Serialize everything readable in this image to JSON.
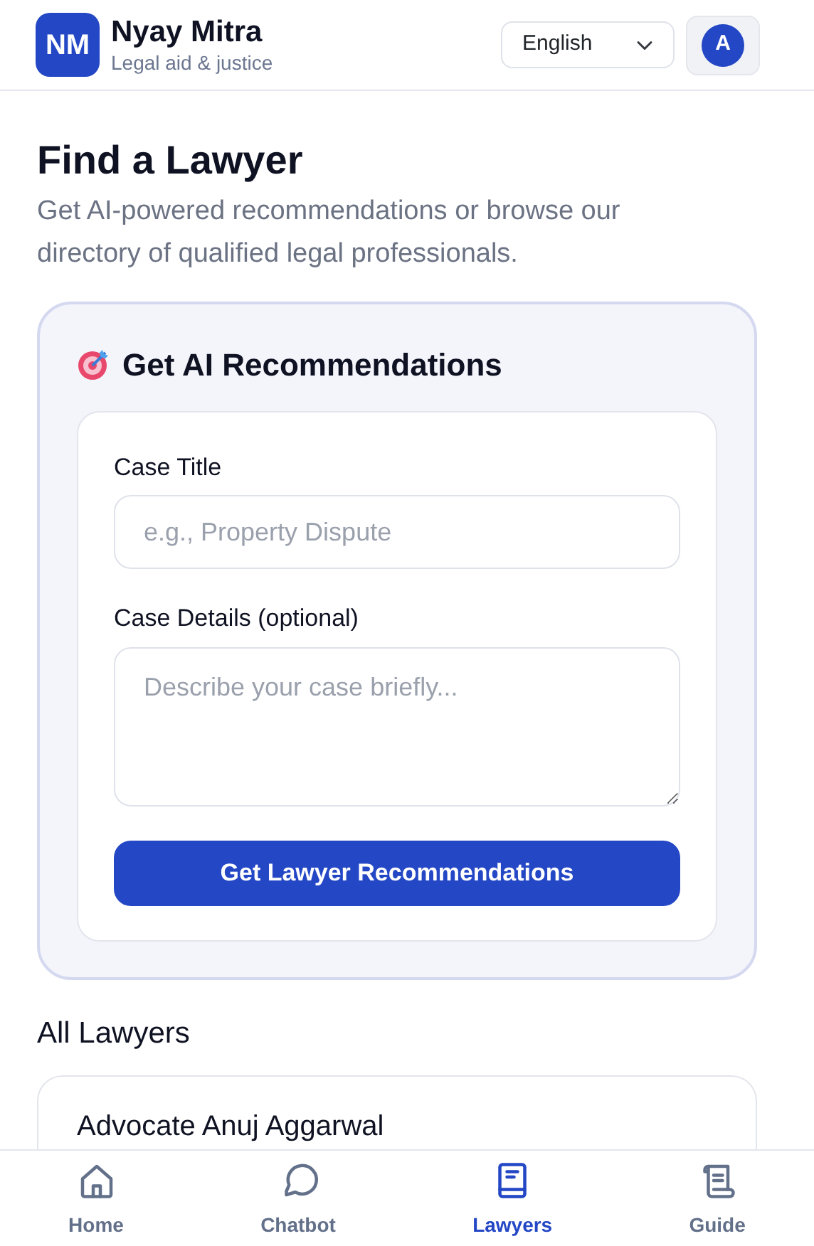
{
  "header": {
    "logo": "NM",
    "title": "Nyay Mitra",
    "subtitle": "Legal aid & justice",
    "language": "English",
    "avatar": "A"
  },
  "page": {
    "title": "Find a Lawyer",
    "description": "Get AI-powered recommendations or browse our directory of qualified legal professionals."
  },
  "ai_card": {
    "title": "Get AI Recommendations",
    "fields": [
      {
        "kind": "input",
        "label": "Case Title",
        "placeholder": "e.g., Property Dispute"
      },
      {
        "kind": "textarea",
        "label": "Case Details (optional)",
        "placeholder": "Describe your case briefly..."
      }
    ],
    "button": "Get Lawyer Recommendations"
  },
  "all_lawyers": {
    "title": "All Lawyers",
    "lawyers": [
      {
        "name": "Advocate Anuj Aggarwal"
      }
    ]
  },
  "bottom_nav": [
    {
      "label": "Home",
      "selected": false
    },
    {
      "label": "Chatbot",
      "selected": false
    },
    {
      "label": "Lawyers",
      "selected": true
    },
    {
      "label": "Guide",
      "selected": false
    }
  ]
}
